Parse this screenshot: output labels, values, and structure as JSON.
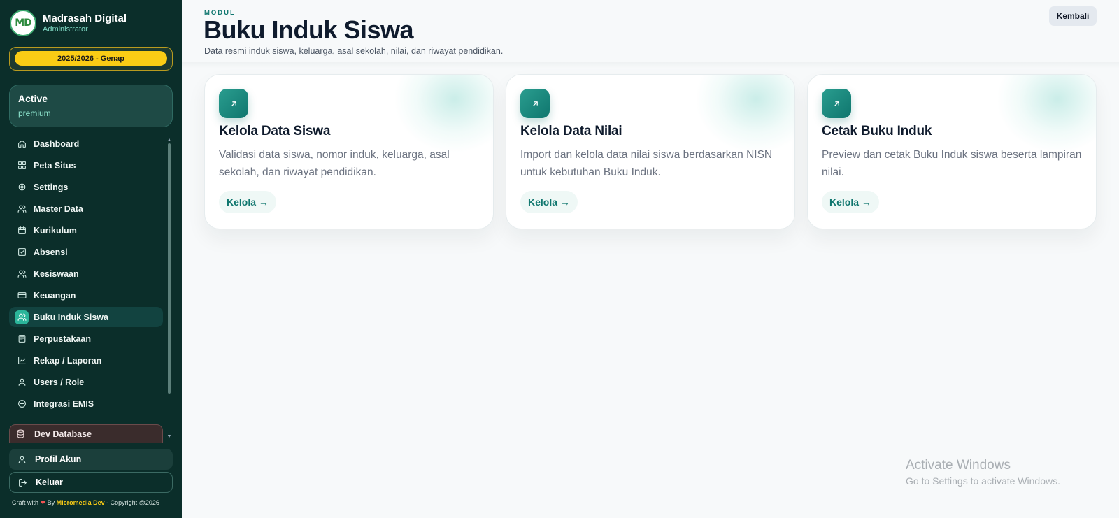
{
  "sidebar": {
    "brand": {
      "logo_text": "MD",
      "title": "Madrasah Digital",
      "subtitle": "Administrator"
    },
    "academic_year": "2025/2026 - Genap",
    "status_card": {
      "title": "Active",
      "subtitle": "premium"
    },
    "menu": [
      {
        "label": "Dashboard",
        "icon": "home-icon",
        "active": false
      },
      {
        "label": "Peta Situs",
        "icon": "grid-icon",
        "active": false
      },
      {
        "label": "Settings",
        "icon": "gear-icon",
        "active": false
      },
      {
        "label": "Master Data",
        "icon": "users-icon",
        "active": false
      },
      {
        "label": "Kurikulum",
        "icon": "calendar-icon",
        "active": false
      },
      {
        "label": "Absensi",
        "icon": "checkbox-icon",
        "active": false
      },
      {
        "label": "Kesiswaan",
        "icon": "users-icon",
        "active": false
      },
      {
        "label": "Keuangan",
        "icon": "card-icon",
        "active": false
      },
      {
        "label": "Buku Induk Siswa",
        "icon": "users-icon",
        "active": true
      },
      {
        "label": "Perpustakaan",
        "icon": "book-icon",
        "active": false
      },
      {
        "label": "Rekap / Laporan",
        "icon": "chart-icon",
        "active": false
      },
      {
        "label": "Users / Role",
        "icon": "user-icon",
        "active": false
      },
      {
        "label": "Integrasi EMIS",
        "icon": "plus-circle-icon",
        "active": false
      }
    ],
    "dev_database": "Dev Database",
    "profile": "Profil Akun",
    "logout": "Keluar",
    "footer": {
      "prefix": "Craft with",
      "heart": "❤",
      "by": "By",
      "brand": "Micromedia Dev",
      "copyright": "- Copyright @2026"
    }
  },
  "header": {
    "eyebrow": "MODUL",
    "title": "Buku Induk Siswa",
    "description": "Data resmi induk siswa, keluarga, asal sekolah, nilai, dan riwayat pendidikan.",
    "back_button": "Kembali"
  },
  "cards": [
    {
      "icon": "arrow-up-right-icon",
      "title": "Kelola Data Siswa",
      "description": "Validasi data siswa, nomor induk, keluarga, asal sekolah, dan riwayat pendidikan.",
      "action": "Kelola →"
    },
    {
      "icon": "arrow-up-right-icon",
      "title": "Kelola Data Nilai",
      "description": "Import dan kelola data nilai siswa berdasarkan NISN untuk kebutuhan Buku Induk.",
      "action": "Kelola →"
    },
    {
      "icon": "arrow-up-right-icon",
      "title": "Cetak Buku Induk",
      "description": "Preview dan cetak Buku Induk siswa beserta lampiran nilai.",
      "action": "Kelola →"
    }
  ],
  "watermark": {
    "line1": "Activate Windows",
    "line2": "Go to Settings to activate Windows."
  },
  "colors": {
    "sidebar_bg": "#0b2e2a",
    "accent": "#0f766e",
    "year_pill": "#facc15"
  }
}
